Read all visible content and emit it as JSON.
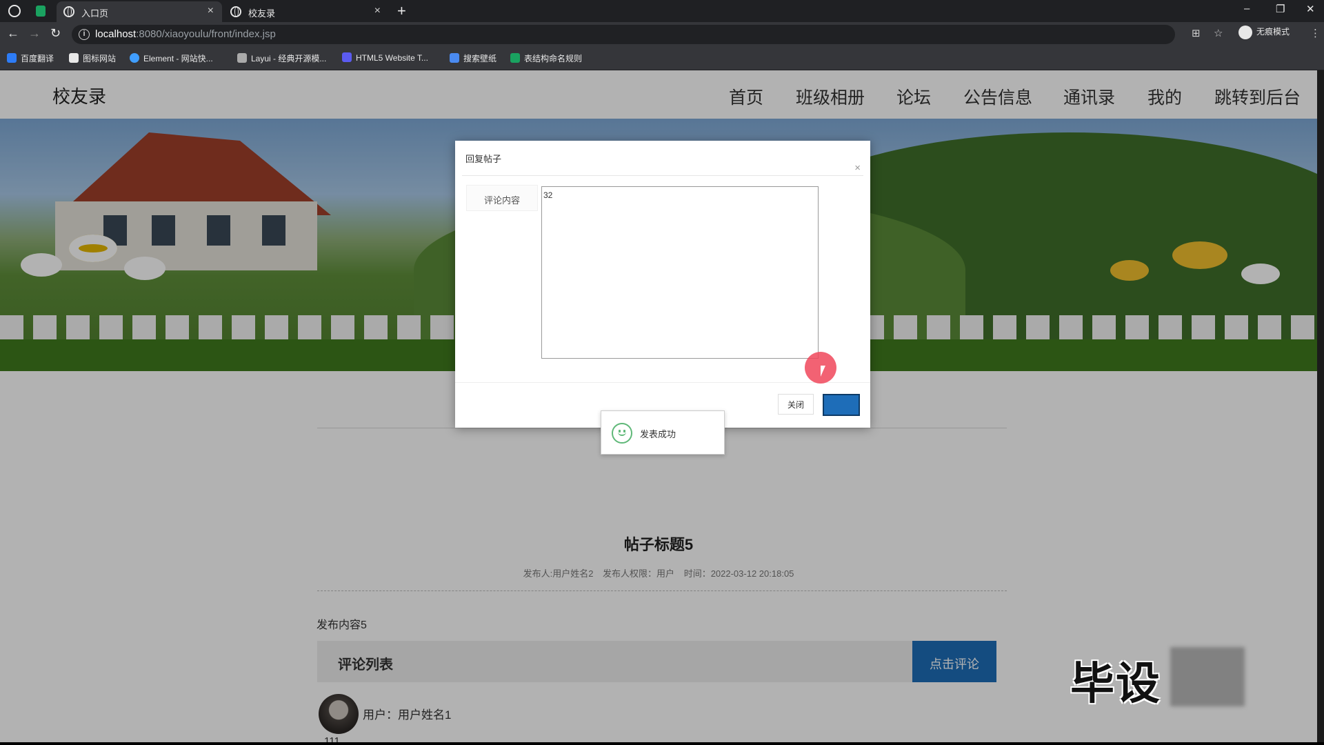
{
  "browser": {
    "tabs": [
      {
        "label": "入口页",
        "active": true
      },
      {
        "label": "校友录",
        "active": false
      }
    ],
    "url_host": "localhost",
    "url_rest": ":8080/xiaoyoulu/front/index.jsp",
    "incognito_label": "无痕模式",
    "bookmarks": [
      "百度翻译",
      "图标网站",
      "Element - 网站快...",
      "Layui - 经典开源模...",
      "HTML5 Website T...",
      "搜索壁纸",
      "表结构命名规则"
    ]
  },
  "site": {
    "title": "校友录",
    "nav": [
      "首页",
      "班级相册",
      "论坛",
      "公告信息",
      "通讯录",
      "我的",
      "跳转到后台"
    ]
  },
  "post": {
    "title": "帖子标题5",
    "meta_author": "发布人:用户姓名2",
    "meta_role": "发布人权限：用户",
    "meta_time": "时间：2022-03-12 20:18:05",
    "content": "发布内容5",
    "comment_list_label": "评论列表",
    "comment_button": "点击评论"
  },
  "comment": {
    "user": "用户：用户姓名1",
    "text": "111"
  },
  "modal": {
    "title": "回复帖子",
    "field_label": "评论内容",
    "field_value": "32",
    "close_button": "关闭",
    "submit_button": ""
  },
  "toast": {
    "text": "发表成功"
  },
  "watermark": {
    "text": "毕设"
  },
  "colors": {
    "primary": "#1e6db8",
    "success": "#5fb878",
    "cursor": "#f0465a"
  }
}
